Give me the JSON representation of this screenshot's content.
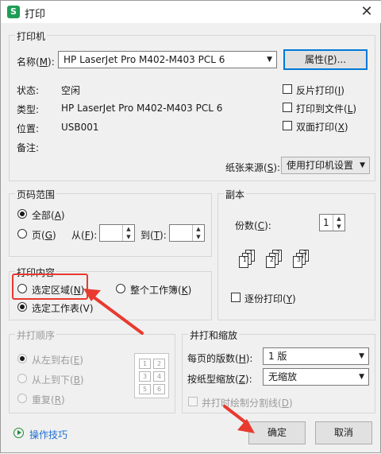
{
  "window": {
    "title": "打印",
    "app_icon": "S",
    "close_glyph": "✕"
  },
  "printer": {
    "group_label": "打印机",
    "name_label": "名称(",
    "name_key": "M",
    "name_tail": "):",
    "name_value": "HP LaserJet Pro M402-M403 PCL 6",
    "properties_label": "属性(",
    "properties_key": "P",
    "properties_tail": ")...",
    "status_label": "状态:",
    "status_value": "空闲",
    "type_label": "类型:",
    "type_value": "HP LaserJet Pro M402-M403 PCL 6",
    "location_label": "位置:",
    "location_value": "USB001",
    "comment_label": "备注:",
    "reverse_print": {
      "text": "反片打印(",
      "key": "I",
      "tail": ")"
    },
    "print_to_file": {
      "text": "打印到文件(",
      "key": "L",
      "tail": ")"
    },
    "duplex": {
      "text": "双面打印(",
      "key": "X",
      "tail": ")"
    },
    "paper_source_label": "纸张来源(",
    "paper_source_key": "S",
    "paper_source_tail": "):",
    "paper_source_value": "使用打印机设置"
  },
  "page_range": {
    "group_label": "页码范围",
    "all": {
      "text": "全部(",
      "key": "A",
      "tail": ")"
    },
    "pages": {
      "text": "页(",
      "key": "G",
      "tail": ")"
    },
    "from": {
      "text": "从(",
      "key": "F",
      "tail": "):"
    },
    "to": {
      "text": "到(",
      "key": "T",
      "tail": "):"
    }
  },
  "copies": {
    "group_label": "副本",
    "count_label": "份数(",
    "count_key": "C",
    "count_tail": "):",
    "count_value": "1",
    "collate": {
      "text": "逐份打印(",
      "key": "Y",
      "tail": ")"
    }
  },
  "print_content": {
    "group_label": "打印内容",
    "selection": {
      "text": "选定区域(",
      "key": "N",
      "tail": ")"
    },
    "workbook": {
      "text": "整个工作簿(",
      "key": "K",
      "tail": ")"
    },
    "worksheet": "选定工作表(V)"
  },
  "merge_order": {
    "group_label": "并打顺序",
    "left_right": {
      "text": "从左到右(",
      "key": "E",
      "tail": ")"
    },
    "top_bottom": {
      "text": "从上到下(",
      "key": "B",
      "tail": ")"
    },
    "repeat": {
      "text": "重复(",
      "key": "R",
      "tail": ")"
    }
  },
  "merge_zoom": {
    "group_label": "并打和缩放",
    "pages_per_sheet_label": "每页的版数(",
    "pages_per_sheet_key": "H",
    "pages_per_sheet_tail": "):",
    "pages_per_sheet_value": "1 版",
    "scale_label": "按纸型缩放(",
    "scale_key": "Z",
    "scale_tail": "):",
    "scale_value": "无缩放",
    "divider": {
      "text": "并打时绘制分割线(",
      "key": "D",
      "tail": ")"
    }
  },
  "footer": {
    "tips_label": "操作技巧",
    "ok_label": "确定",
    "cancel_label": "取消"
  },
  "colors": {
    "annotation": "#e83a2f",
    "focus": "#0078d7",
    "link": "#1e6fd0"
  }
}
